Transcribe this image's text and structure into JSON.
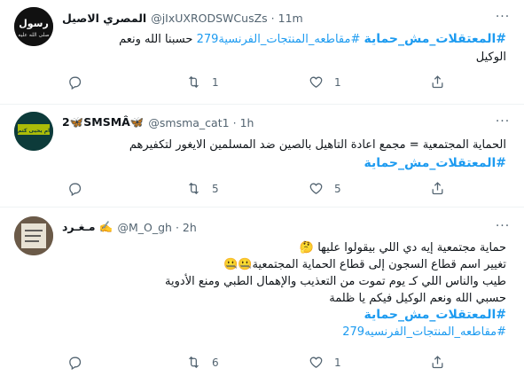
{
  "tweets": [
    {
      "name": "المصري الاصيل",
      "handle": "@jIxUXRODSWCusZs",
      "time": "11m",
      "line1_tag": "#المعتقلات_مش_حماية",
      "line1_tag2": "#مقاطعه_المنتجات_الفرنسية279",
      "line1_text": "حسبنا الله ونعم",
      "line2_text": "الوكيل",
      "avatar_text": "رسول",
      "avatar_sub": "صلى الله عليه",
      "replies": "",
      "retweets": "1",
      "likes": "1"
    },
    {
      "name": "2🦋SMSMÂ🦋",
      "handle": "@smsma_cat1",
      "time": "1h",
      "line1_text": "الحماية المجتمعية = مجمع اعادة التاهيل بالصين ضد المسلمين الايغور لتكفيرهم",
      "line2_tag": "#المعتقلات_مش_حماية",
      "avatar_text": "ام يحيى كتم",
      "replies": "",
      "retweets": "5",
      "likes": "5"
    },
    {
      "name": "مـغـرد ✍️",
      "handle": "@M_O_gh",
      "time": "2h",
      "line1": "حماية مجتمعية إيه دي اللي بيقولوا عليها 🤔",
      "line2": "تغيير اسم قطاع السجون إلى قطاع الحماية المجتمعية🤐🤐",
      "line3": "طيب والناس اللي كـ يوم تموت من التعذيب والإهمال الطبي ومنع الأدوية",
      "line4": "حسبي الله ونعم الوكيل فيكم يا ظلمة",
      "tag1": "#المعتقلات_مش_حماية",
      "tag2": "#مقاطعه_المنتجات_الفرنسيه279",
      "replies": "",
      "retweets": "6",
      "likes": "1"
    }
  ],
  "icons": {
    "more": "more-icon",
    "reply": "reply-icon",
    "retweet": "retweet-icon",
    "like": "heart-icon",
    "share": "share-icon"
  },
  "colors": {
    "hashtag": "#1d9bf0",
    "secondary": "#536471",
    "divider": "#eff3f4"
  }
}
